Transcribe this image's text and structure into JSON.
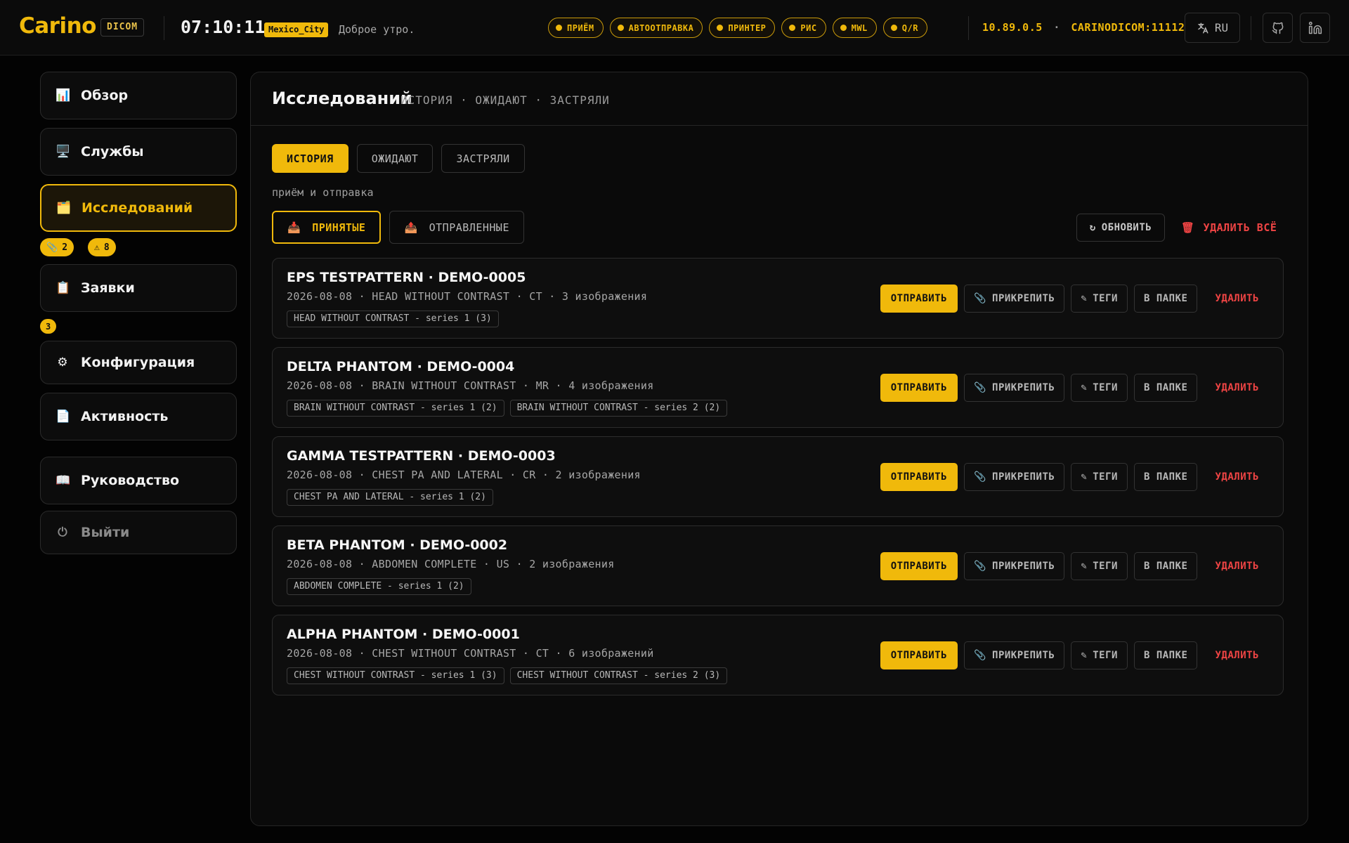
{
  "header": {
    "logo": "Carino",
    "product_badge": "DICOM",
    "clock": "07:10:11",
    "timezone": "Mexico_City",
    "greeting": "Доброе утро.",
    "services": [
      "ПРИЁМ",
      "АВТООТПРАВКА",
      "ПРИНТЕР",
      "РИС",
      "MWL",
      "Q/R"
    ],
    "ip": "10.89.0.5",
    "separator": "·",
    "ae_port": "CARINODICOM:11112",
    "language": "RU",
    "accent_color": "#f0b90b"
  },
  "sidebar": {
    "items": [
      {
        "label": "Обзор",
        "icon": "chart-icon"
      },
      {
        "label": "Службы",
        "icon": "monitor-icon"
      },
      {
        "label": "Исследований",
        "icon": "folder-icon",
        "active": true
      },
      {
        "label": "Заявки",
        "icon": "clipboard-icon"
      },
      {
        "label": "Конфигурация",
        "icon": "gear-icon"
      },
      {
        "label": "Активность",
        "icon": "document-icon"
      },
      {
        "label": "Руководство",
        "icon": "book-icon"
      },
      {
        "label": "Выйти",
        "icon": "power-icon"
      }
    ],
    "studies_badges": {
      "attached": "2",
      "warnings": "8"
    },
    "requests_badge": "3"
  },
  "main": {
    "title": "Исследований",
    "subtitle": "ИСТОРИЯ · ОЖИДАЮТ · ЗАСТРЯЛИ",
    "tabs": [
      "ИСТОРИЯ",
      "ОЖИДАЮТ",
      "ЗАСТРЯЛИ"
    ],
    "hint": "приём и отправка",
    "subtabs": [
      "ПРИНЯТЫЕ",
      "ОТПРАВЛЕННЫЕ"
    ],
    "refresh_label": "ОБНОВИТЬ",
    "delete_all_label": "УДАЛИТЬ ВСЁ",
    "action_labels": {
      "send": "ОТПРАВИТЬ",
      "attach": "ПРИКРЕПИТЬ",
      "tags": "ТЕГИ",
      "folder": "В ПАПКЕ",
      "delete": "УДАЛИТЬ"
    },
    "studies": [
      {
        "title": "EPS TESTPATTERN · DEMO-0005",
        "meta": "2026-08-08 · HEAD WITHOUT CONTRAST · CT · 3 изображения",
        "series": [
          "HEAD WITHOUT CONTRAST - series 1 (3)"
        ]
      },
      {
        "title": "DELTA PHANTOM · DEMO-0004",
        "meta": "2026-08-08 · BRAIN WITHOUT CONTRAST · MR · 4 изображения",
        "series": [
          "BRAIN WITHOUT CONTRAST - series 1 (2)",
          "BRAIN WITHOUT CONTRAST - series 2 (2)"
        ]
      },
      {
        "title": "GAMMA TESTPATTERN · DEMO-0003",
        "meta": "2026-08-08 · CHEST PA AND LATERAL · CR · 2 изображения",
        "series": [
          "CHEST PA AND LATERAL - series 1 (2)"
        ]
      },
      {
        "title": "BETA PHANTOM · DEMO-0002",
        "meta": "2026-08-08 · ABDOMEN COMPLETE · US · 2 изображения",
        "series": [
          "ABDOMEN COMPLETE - series 1 (2)"
        ]
      },
      {
        "title": "ALPHA PHANTOM · DEMO-0001",
        "meta": "2026-08-08 · CHEST WITHOUT CONTRAST · CT · 6 изображений",
        "series": [
          "CHEST WITHOUT CONTRAST - series 1 (3)",
          "CHEST WITHOUT CONTRAST - series 2 (3)"
        ]
      }
    ]
  }
}
